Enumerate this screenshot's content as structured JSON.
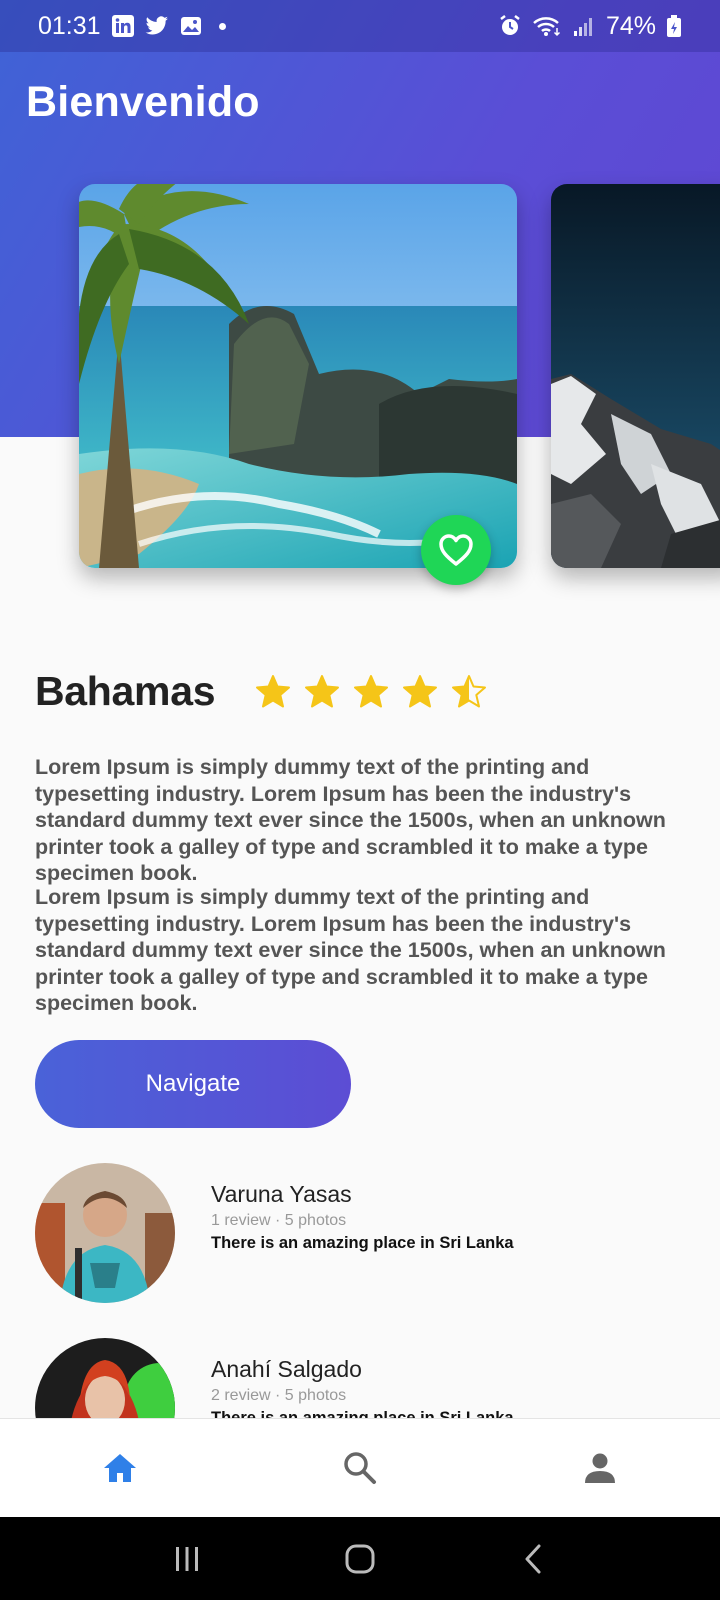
{
  "status_bar": {
    "time": "01:31",
    "battery": "74%",
    "left_icons": [
      "linkedin-icon",
      "twitter-icon",
      "gallery-icon",
      "dot-icon"
    ],
    "right_icons": [
      "alarm-icon",
      "wifi-icon",
      "signal-icon",
      "battery-icon"
    ]
  },
  "header": {
    "title": "Bienvenido"
  },
  "carousel": {
    "cards": [
      {
        "scene": "beach-waterfall"
      },
      {
        "scene": "snowy-mountain"
      }
    ],
    "favorite_icon": "heart-icon"
  },
  "place": {
    "name": "Bahamas",
    "rating": 4.5,
    "rating_max": 5,
    "star_color": "#f5c518"
  },
  "description": {
    "paragraphs": [
      "Lorem Ipsum is simply dummy text of the printing and typesetting industry. Lorem Ipsum has been the industry's standard dummy text ever since the 1500s, when an unknown printer took a galley of type and scrambled it to make a type specimen book.",
      "Lorem Ipsum is simply dummy text of the printing and typesetting industry. Lorem Ipsum has been the industry's standard dummy text ever since the 1500s, when an unknown printer took a galley of type and scrambled it to make a type specimen book."
    ]
  },
  "navigate_button": {
    "label": "Navigate"
  },
  "reviews": [
    {
      "name": "Varuna Yasas",
      "meta": "1 review · 5 photos",
      "comment": "There is an amazing place in Sri Lanka"
    },
    {
      "name": "Anahí Salgado",
      "meta": "2 review · 5 photos",
      "comment": "There is an amazing place in Sri Lanka"
    }
  ],
  "bottom_nav": {
    "tabs": [
      {
        "icon": "home-icon",
        "active": true
      },
      {
        "icon": "search-icon",
        "active": false
      },
      {
        "icon": "profile-icon",
        "active": false
      }
    ],
    "active_color": "#2f80e8",
    "inactive_color": "#666666"
  },
  "system_nav": [
    "recents-icon",
    "home-circle-icon",
    "back-icon"
  ],
  "colors": {
    "accent": "#5a4ed6",
    "favorite": "#1fd656"
  }
}
